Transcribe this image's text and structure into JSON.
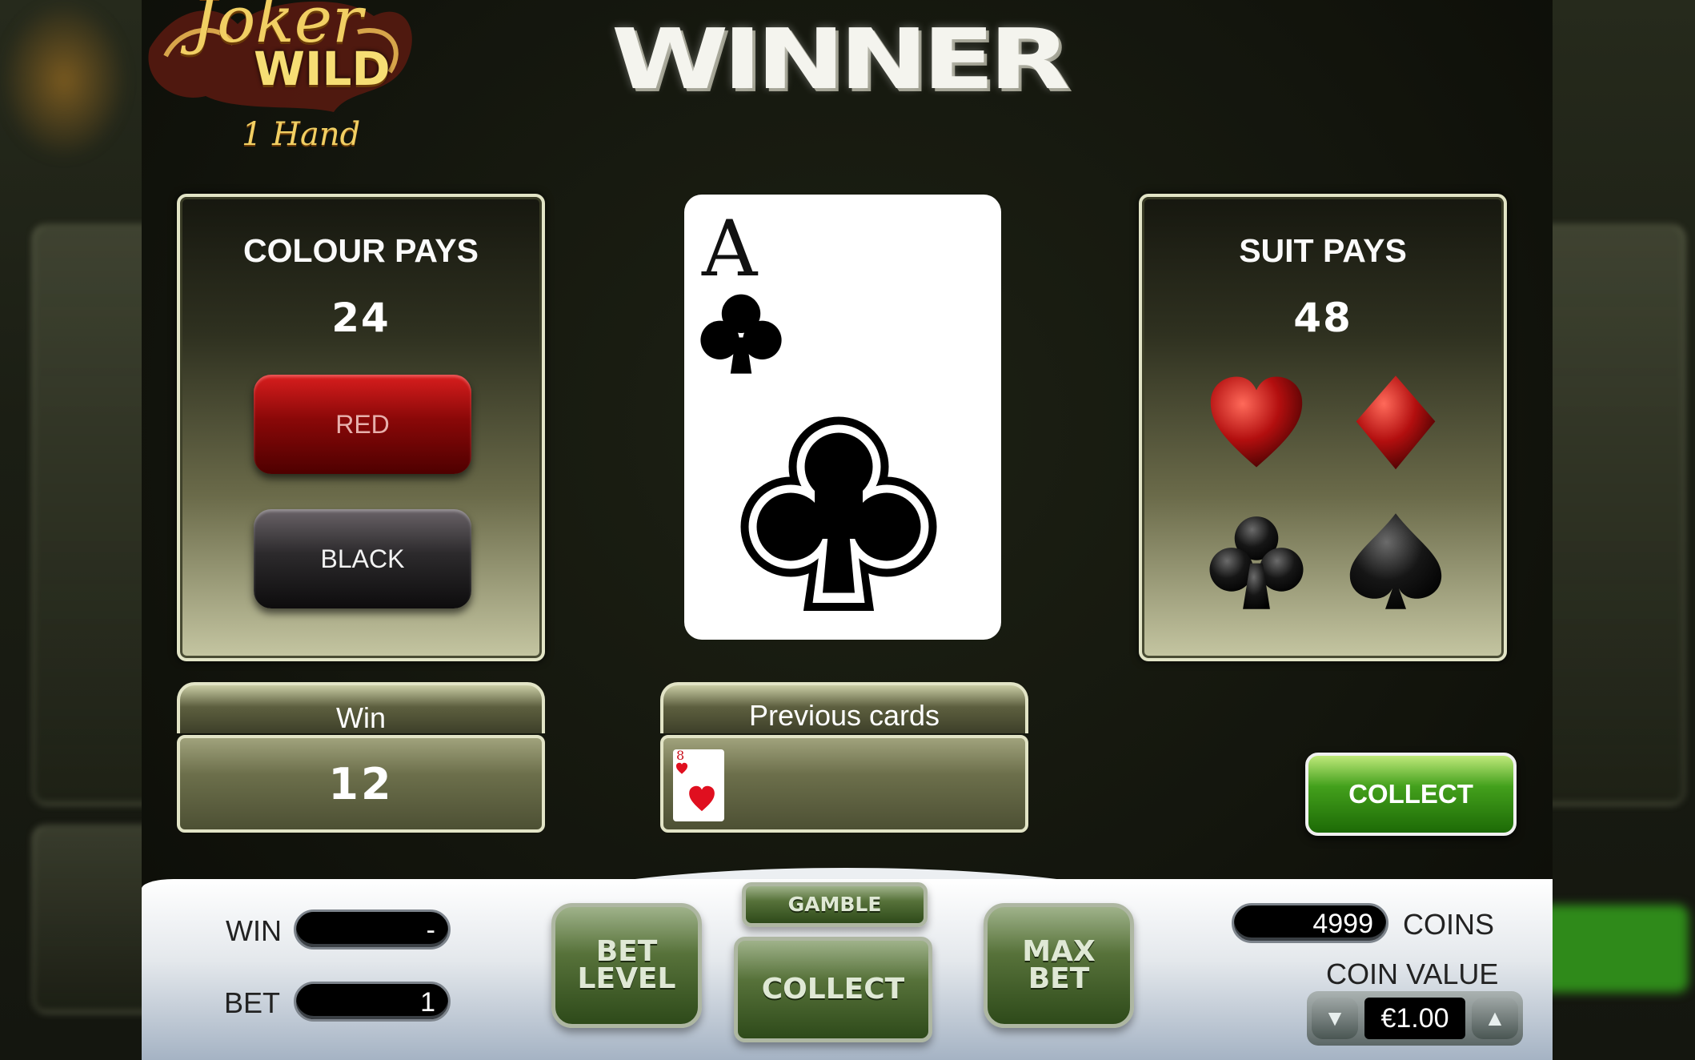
{
  "header": {
    "logo_line1": "Joker",
    "logo_line2": "WILD",
    "logo_line3": "1 Hand",
    "banner": "WINNER"
  },
  "colour_panel": {
    "title": "COLOUR PAYS",
    "value": "24",
    "red_label": "RED",
    "black_label": "BLACK"
  },
  "suit_panel": {
    "title": "SUIT PAYS",
    "value": "48",
    "suits": [
      "heart",
      "diamond",
      "club",
      "spade"
    ]
  },
  "current_card": {
    "rank": "A",
    "suit": "club"
  },
  "win_panel": {
    "label": "Win",
    "value": "12"
  },
  "previous_cards": {
    "label": "Previous cards",
    "cards": [
      {
        "rank": "8",
        "suit": "heart"
      }
    ]
  },
  "collect_top_label": "COLLECT",
  "console": {
    "win_label": "WIN",
    "win_value": "-",
    "bet_label": "BET",
    "bet_value": "1",
    "bet_level_line1": "BET",
    "bet_level_line2": "LEVEL",
    "gamble_label": "GAMBLE",
    "collect_label": "COLLECT",
    "max_bet_line1": "MAX",
    "max_bet_line2": "BET",
    "coins_value": "4999",
    "coins_label": "COINS",
    "coin_value_label": "COIN VALUE",
    "coin_value": "€1.00"
  },
  "colors": {
    "red": "#b30f0f",
    "green": "#43a01c",
    "panel_border": "#e2e4c6",
    "gold": "#e0b84a"
  }
}
